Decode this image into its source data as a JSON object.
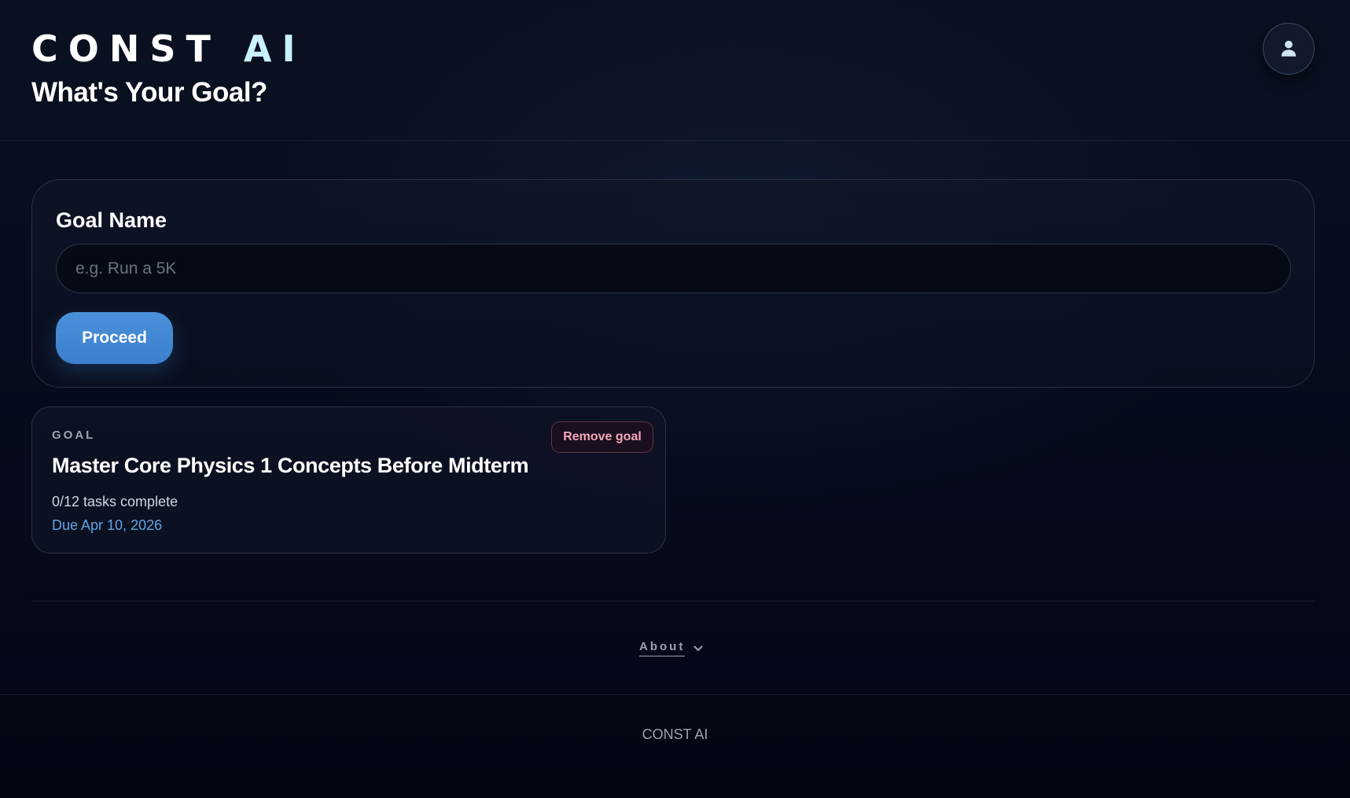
{
  "header": {
    "brand_part1": "CONST",
    "brand_part2": "AI",
    "title": "What's Your Goal?",
    "profile_icon": "user-icon"
  },
  "form": {
    "label": "Goal Name",
    "input_value": "",
    "input_placeholder": "e.g. Run a 5K",
    "proceed_label": "Proceed"
  },
  "goals": [
    {
      "kicker": "GOAL",
      "title": "Master Core Physics 1 Concepts Before Midterm",
      "progress": "0/12 tasks complete",
      "due": "Due Apr 10, 2026",
      "remove_label": "Remove goal"
    }
  ],
  "about": {
    "label": "About",
    "icon": "chevron-down-icon"
  },
  "footer": {
    "text": "CONST AI"
  },
  "colors": {
    "accent": "#3b7fce",
    "due_text": "#60a5e6",
    "remove_text": "#f4a6b8",
    "brand_ai": "#c9f0ff",
    "background": "#050816"
  }
}
